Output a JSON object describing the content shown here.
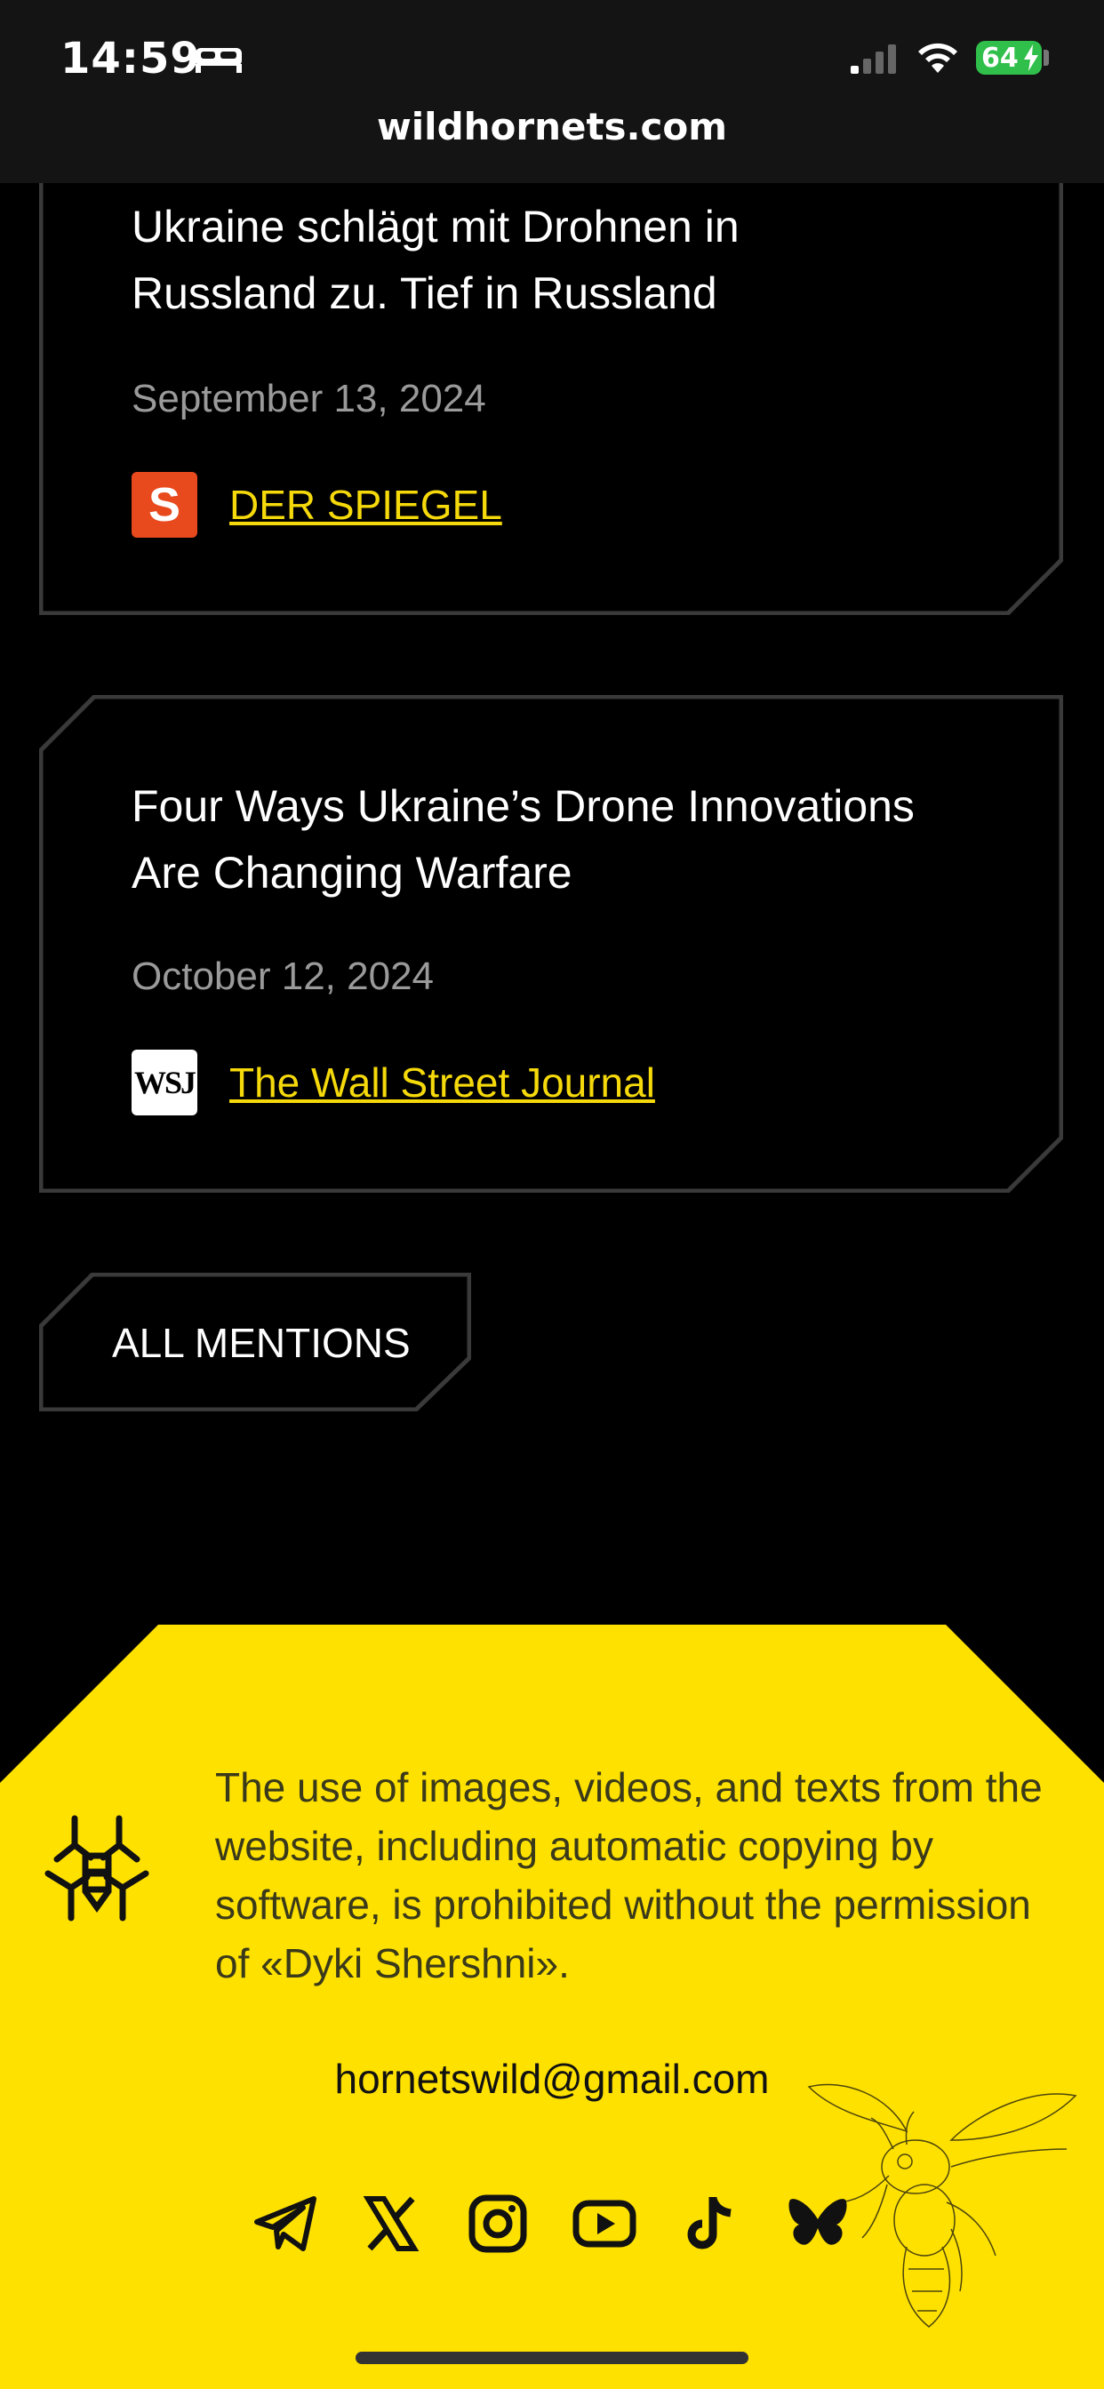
{
  "status_bar": {
    "time": "14:59",
    "battery": "64",
    "icons": [
      "sleep-bed-icon",
      "cellular-signal-icon",
      "wifi-icon",
      "charging-bolt-icon"
    ]
  },
  "browser": {
    "url": "wildhornets.com"
  },
  "mentions": [
    {
      "title": "Ukraine schlägt mit Drohnen in Russland zu. Tief in Russland",
      "date": "September 13, 2024",
      "source": "DER SPIEGEL",
      "source_logo_letter": "S"
    },
    {
      "title": "Four Ways Ukraine’s Drone Innovations Are Changing Warfare",
      "date": "October 12, 2024",
      "source": "The Wall Street Journal",
      "source_logo_letter": "WSJ"
    }
  ],
  "all_mentions_button": "ALL MENTIONS",
  "footer": {
    "notice": "The use of images, videos, and texts from the website, including automatic copying by software, is prohibited without the permission of «Dyki Shershni».",
    "email": "hornetswild@gmail.com",
    "socials": [
      "telegram-icon",
      "x-icon",
      "instagram-icon",
      "youtube-icon",
      "tiktok-icon",
      "bluesky-icon"
    ]
  },
  "colors": {
    "accent_yellow": "#FFE100",
    "link_yellow": "#F5D90A",
    "background": "#000000",
    "card_border": "#3A3A3A"
  }
}
